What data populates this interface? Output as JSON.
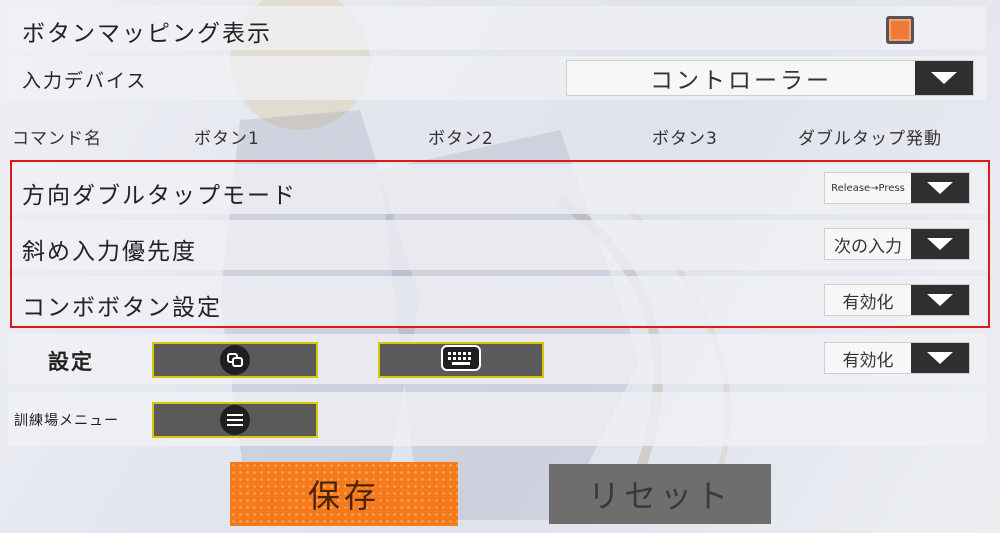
{
  "mapping_display": {
    "label": "ボタンマッピング表示",
    "checked": true
  },
  "input_device": {
    "label": "入力デバイス",
    "value": "コントローラー"
  },
  "headers": [
    "コマンド名",
    "ボタン1",
    "ボタン2",
    "ボタン3",
    "ダブルタップ発動"
  ],
  "rows": [
    {
      "label": "方向ダブルタップモード",
      "value": "Release→Press"
    },
    {
      "label": "斜め入力優先度",
      "value": "次の入力"
    },
    {
      "label": "コンボボタン設定",
      "value": "有効化"
    }
  ],
  "settings_row": {
    "label": "設定",
    "value": "有効化",
    "button1_icon": "window-swap-icon",
    "button2_icon": "keyboard-icon"
  },
  "training_menu": {
    "label": "訓練場メニュー",
    "button1_icon": "menu-icon"
  },
  "buttons": {
    "save": "保存",
    "reset": "リセット"
  },
  "colors": {
    "accent": "#f57a1c",
    "highlight_frame": "#e01818",
    "key_border": "#d8c800"
  }
}
